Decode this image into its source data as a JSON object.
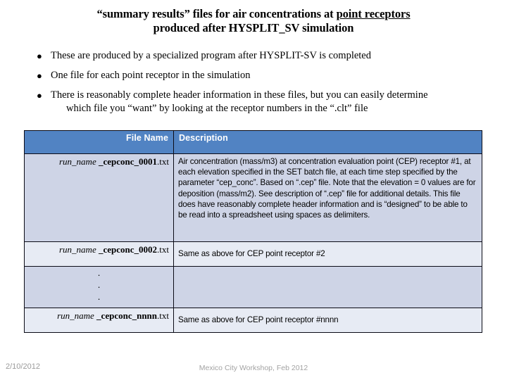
{
  "title": {
    "line1_before": "“summary results” files for air concentrations at ",
    "line1_underlined": "point receptors",
    "line2": "produced after HYSPLIT_SV simulation"
  },
  "bullets": {
    "marker": "●",
    "items": [
      {
        "line1": "These are produced by a specialized program after HYSPLIT-SV is completed",
        "line2": ""
      },
      {
        "line1": "One file for each point receptor in the simulation",
        "line2": ""
      },
      {
        "line1": "There is reasonably complete header information in these files, but you can easily determine",
        "line2": "which file you “want” by looking at the receptor numbers in the “.clt” file"
      }
    ]
  },
  "table": {
    "headers": {
      "file_name": "File Name",
      "description": "Description"
    },
    "rows": [
      {
        "run": "run_name",
        "stem": " _cepconc_0001",
        "ext": ".txt",
        "description": "Air concentration (mass/m3) at concentration evaluation point (CEP) receptor #1, at each elevation specified in the SET batch file, at each time step specified by the parameter “cep_conc”. Based on “.cep” file.  Note that the elevation = 0 values are for deposition (mass/m2). See description of “.cep” file for additional details. This file does have reasonably complete header information and is “designed” to be able to be read into a spreadsheet using spaces as delimiters."
      },
      {
        "run": "run_name",
        "stem": " _cepconc_0002",
        "ext": ".txt",
        "description": "Same as above for CEP point receptor #2"
      },
      {
        "dots": "·",
        "description": ""
      },
      {
        "run": "run_name",
        "stem": " _cepconc_nnnn",
        "ext": ".txt",
        "description": "Same as above for CEP point receptor #nnnn"
      }
    ]
  },
  "footer": {
    "date": "2/10/2012",
    "center": "Mexico City Workshop, Feb 2012"
  },
  "colors": {
    "header_blue": "#5183c3",
    "band_dark": "#ced4e6",
    "band_light": "#e7ebf4",
    "border": "#0b0b16",
    "footer_text": "#a3a3a3"
  }
}
